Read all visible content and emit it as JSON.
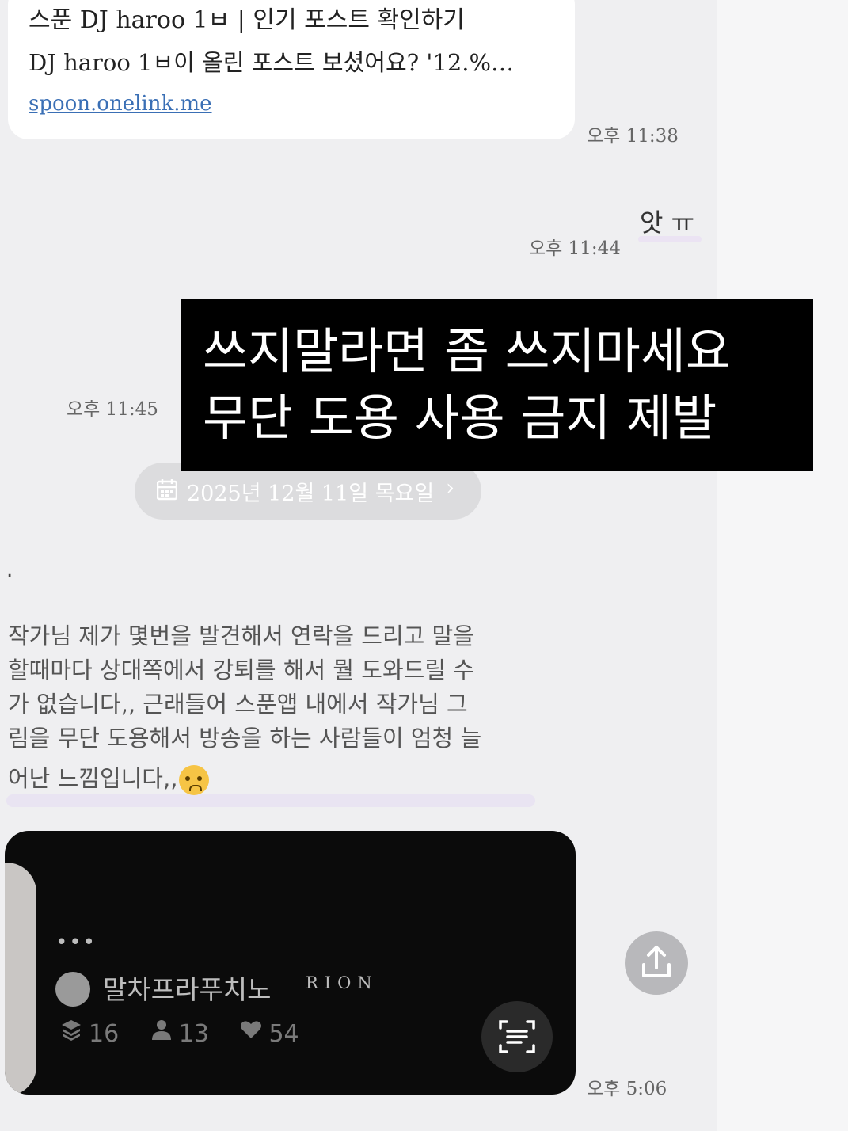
{
  "link_card": {
    "title": "스푼 DJ haroo 1ㅂ | 인기 포스트 확인하기",
    "description": "DJ haroo 1ㅂ이 올린 포스트 보셨어요? '12.%…",
    "url": "spoon.onelink.me"
  },
  "times": {
    "t1": "오후 11:38",
    "t2": "오후 11:44",
    "t3": "오후 11:45",
    "t4": "오후 5:06"
  },
  "short_message": "앗 ㅠ",
  "date_separator": "2025년 12월 11일 목요일",
  "overlay": {
    "line1": "쓰지말라면 좀 쓰지마세요",
    "line2": "무단 도용 사용 금지 제발"
  },
  "dot_message": ".",
  "long_message": {
    "lines": [
      "작가님 제가 몇번을 발견해서 연락을 드리고 말을",
      "할때마다 상대쪽에서 강퇴를 해서 뭘 도와드릴 수",
      "가 없습니다,, 근래들어 스푼앱 내에서 작가님 그",
      "림을 무단 도용해서 방송을 하는 사람들이 엄청 늘",
      "어난 느낌입니다,,"
    ],
    "emoji": "crying-face"
  },
  "media_card": {
    "more": "•••",
    "cafe_name": "말차프라푸치노",
    "cafe_tag": "RION",
    "stats": {
      "layers": "16",
      "members": "13",
      "likes": "54"
    }
  },
  "colors": {
    "background": "#efeff1",
    "overlay_bg": "#000000",
    "media_bg": "#0b0b0b",
    "link": "#3a6fb5"
  }
}
